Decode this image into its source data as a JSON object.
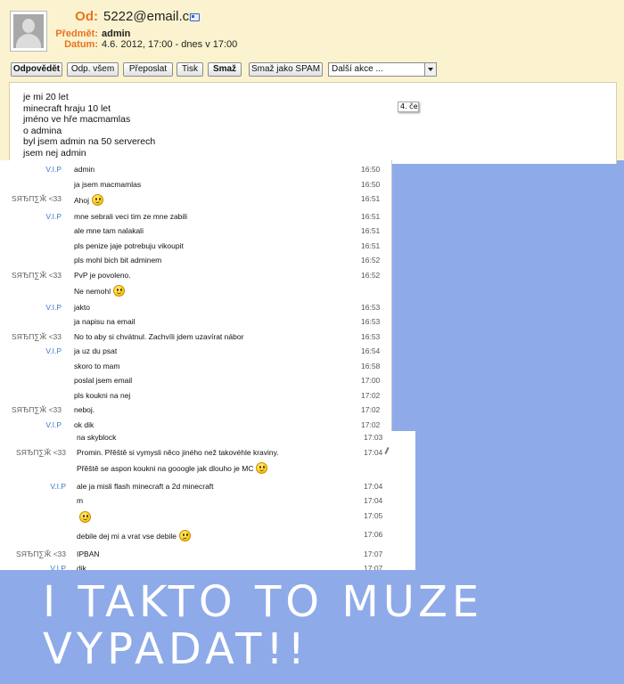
{
  "email": {
    "from_label": "Od:",
    "from_value": "5222@email.cz",
    "subject_label": "Předmět:",
    "subject_value": "admin",
    "date_label": "Datum:",
    "date_value": "4.6. 2012, 17:00 - dnes v 17:00",
    "icons": {
      "avatar": "user-avatar-icon",
      "contact": "contact-card-icon"
    },
    "accent_color": "#e8731e",
    "panel_color": "#fbf3cf"
  },
  "toolbar": {
    "reply": "Odpovědět",
    "reply_all": "Odp. všem",
    "forward": "Přeposlat",
    "print": "Tisk",
    "delete": "Smaž",
    "spam": "Smaž jako SPAM",
    "more": "Další akce ..."
  },
  "body_lines": [
    "je mi 20 let",
    "minecraft hraju 10 let",
    "jméno ve hře macmamlas",
    "o admina",
    "byl jsem admin na 50 serverech",
    "jsem nej admin"
  ],
  "chat1": [
    {
      "sender": "V.I.P",
      "msg": "admin",
      "time": "16:50"
    },
    {
      "sender": "",
      "msg": "ja jsem macmamlas",
      "time": "16:50"
    },
    {
      "sender": "ЅЯЂП∑Ӂ <33",
      "msg": "Ahoj",
      "time": "16:51",
      "smiley": true
    },
    {
      "sender": "V.I.P",
      "msg": "mne sebrali veci tim ze mne zabili",
      "time": "16:51"
    },
    {
      "sender": "",
      "msg": "ale mne tam nalakali",
      "time": "16:51"
    },
    {
      "sender": "",
      "msg": "pls penize jaje potrebuju vikoupit",
      "time": "16:51"
    },
    {
      "sender": "",
      "msg": "pls mohl bich bit adminem",
      "time": "16:52"
    },
    {
      "sender": "ЅЯЂП∑Ӂ <33",
      "msg": "PvP je povoleno.",
      "time": "16:52"
    },
    {
      "sender": "",
      "msg": "Ne nemohl",
      "time": "",
      "smiley": true
    },
    {
      "sender": "V.I.P",
      "msg": "jakto",
      "time": "16:53"
    },
    {
      "sender": "",
      "msg": "ja napisu na email",
      "time": "16:53"
    },
    {
      "sender": "ЅЯЂП∑Ӂ <33",
      "msg": "No to aby si chvátnul. Zachvíli jdem uzavírat nábor",
      "time": "16:53"
    },
    {
      "sender": "V.I.P",
      "msg": "ja uz du psat",
      "time": "16:54"
    },
    {
      "sender": "",
      "msg": "skoro to mam",
      "time": "16:58"
    },
    {
      "sender": "",
      "msg": "poslal jsem email",
      "time": "17:00"
    },
    {
      "sender": "",
      "msg": "pls koukni na nej",
      "time": "17:02"
    },
    {
      "sender": "ЅЯЂП∑Ӂ <33",
      "msg": "neboj.",
      "time": "17:02"
    },
    {
      "sender": "V.I.P",
      "msg": "ok dik",
      "time": "17:02"
    }
  ],
  "chat2": [
    {
      "sender": "",
      "msg": "na skyblock",
      "time": "17:03"
    },
    {
      "sender": "ЅЯЂП∑Ӂ <33",
      "msg": "Promin. Přěště si vymysli něco jiného než takovéhle kraviny.",
      "time": "17:04"
    },
    {
      "sender": "",
      "msg": "Přěště se aspon koukni na gooogle jak dlouho je MC",
      "time": "",
      "smiley": true
    },
    {
      "sender": "V.I.P",
      "msg": "ale ja misli flash minecraft a 2d minecraft",
      "time": "17:04"
    },
    {
      "sender": "",
      "msg": "m",
      "time": "17:04"
    },
    {
      "sender": "",
      "msg": "",
      "time": "17:05",
      "smiley": true
    },
    {
      "sender": "",
      "msg": "debile dej mi a vrat vse debile",
      "time": "17:06",
      "smiley": true,
      "think": true
    },
    {
      "sender": "ЅЯЂП∑Ӂ <33",
      "msg": "IPBAN",
      "time": "17:07"
    },
    {
      "sender": "V.I.P",
      "msg": "dik",
      "time": "17:07"
    }
  ],
  "tooltip_text": "4. če",
  "caption": {
    "line1": "I TAKTO TO MUZE",
    "line2": "VYPADAT!!"
  },
  "colors": {
    "vip": "#3a79c6",
    "background": "#8eaae9"
  }
}
